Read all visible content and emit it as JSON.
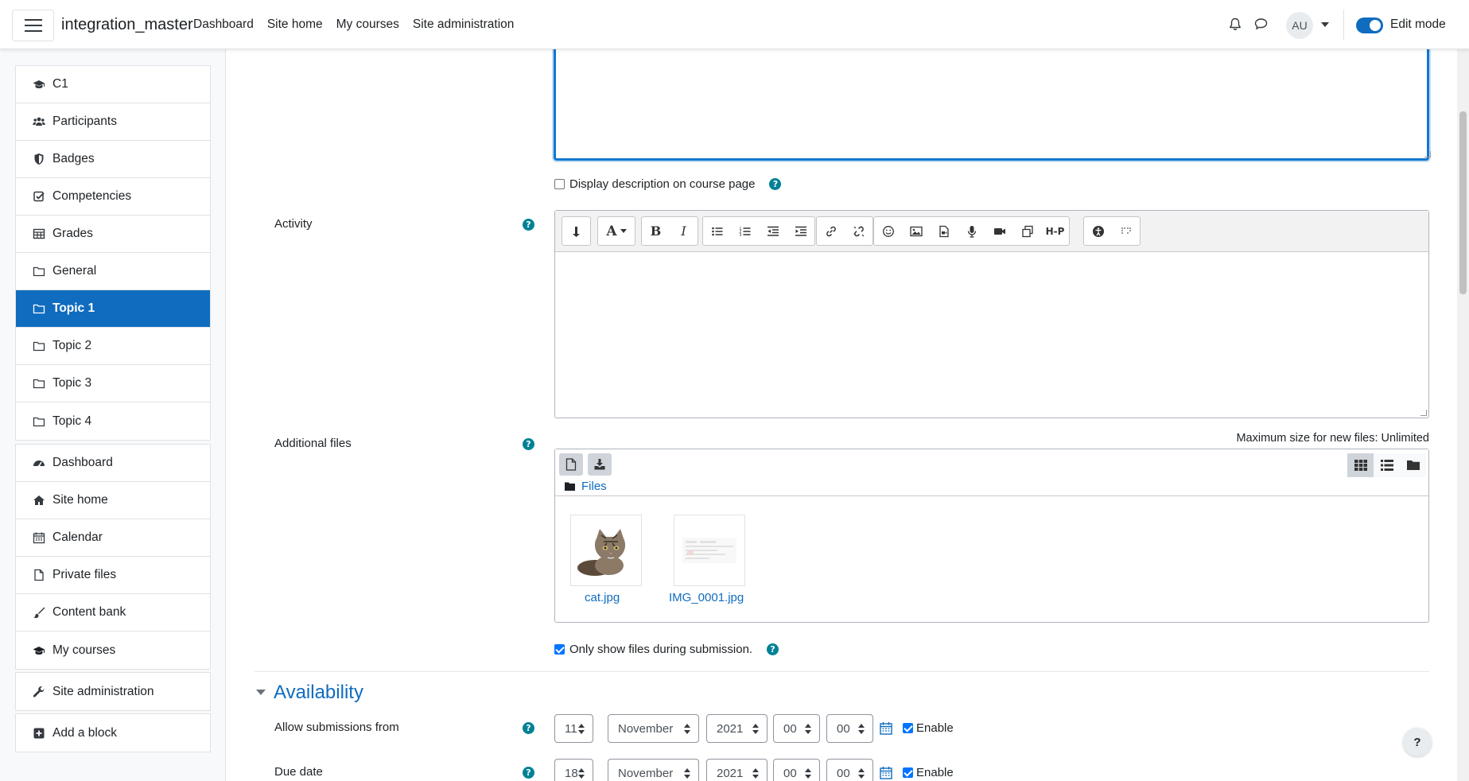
{
  "navbar": {
    "site_name": "integration_master",
    "links": [
      "Dashboard",
      "Site home",
      "My courses",
      "Site administration"
    ],
    "avatar_initials": "AU",
    "edit_mode_label": "Edit mode",
    "edit_mode_on": true
  },
  "drawer": {
    "course_nav": [
      {
        "label": "C1",
        "icon": "graduation-cap-icon"
      },
      {
        "label": "Participants",
        "icon": "users-icon"
      },
      {
        "label": "Badges",
        "icon": "shield-icon"
      },
      {
        "label": "Competencies",
        "icon": "check-square-icon"
      },
      {
        "label": "Grades",
        "icon": "table-icon"
      },
      {
        "label": "General",
        "icon": "folder-icon"
      },
      {
        "label": "Topic 1",
        "icon": "folder-icon",
        "active": true
      },
      {
        "label": "Topic 2",
        "icon": "folder-icon"
      },
      {
        "label": "Topic 3",
        "icon": "folder-icon"
      },
      {
        "label": "Topic 4",
        "icon": "folder-icon"
      }
    ],
    "site_nav": [
      {
        "label": "Dashboard",
        "icon": "tachometer-icon"
      },
      {
        "label": "Site home",
        "icon": "home-icon"
      },
      {
        "label": "Calendar",
        "icon": "calendar-icon"
      },
      {
        "label": "Private files",
        "icon": "file-icon"
      },
      {
        "label": "Content bank",
        "icon": "paint-brush-icon"
      },
      {
        "label": "My courses",
        "icon": "graduation-cap-icon"
      }
    ],
    "admin_nav": [
      {
        "label": "Site administration",
        "icon": "wrench-icon"
      }
    ],
    "add_block": {
      "label": "Add a block",
      "icon": "plus-square-icon"
    }
  },
  "form": {
    "display_description_label": "Display description on course page",
    "display_description_checked": false,
    "activity_label": "Activity",
    "additional_files_label": "Additional files",
    "max_size_label": "Maximum size for new files: Unlimited",
    "files_path_label": "Files",
    "files": [
      {
        "name": "cat.jpg"
      },
      {
        "name": "IMG_0001.jpg"
      }
    ],
    "only_show_files_label": "Only show files during submission.",
    "only_show_files_checked": true
  },
  "availability": {
    "title": "Availability",
    "rows": [
      {
        "label": "Allow submissions from",
        "day": "11",
        "month": "November",
        "year": "2021",
        "hour": "00",
        "minute": "00",
        "enable_label": "Enable",
        "enabled": true
      },
      {
        "label": "Due date",
        "day": "18",
        "month": "November",
        "year": "2021",
        "hour": "00",
        "minute": "00",
        "enable_label": "Enable",
        "enabled": true
      }
    ]
  },
  "help_button_label": "?",
  "colors": {
    "primary": "#0f6cbf",
    "help": "#008196"
  }
}
